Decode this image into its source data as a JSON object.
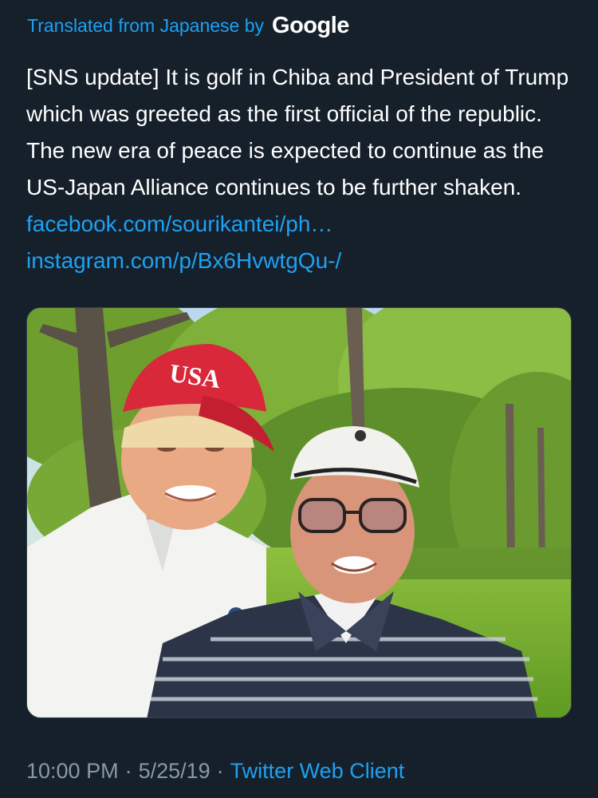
{
  "translation": {
    "prefix": "Translated from Japanese by",
    "provider": "Google"
  },
  "tweet": {
    "text": "[SNS update] It is golf in Chiba and President of Trump which was greeted as the first official of the republic. The new era of peace is expected to continue as the US-Japan Alliance continues to be further shaken. ",
    "link1": "facebook.com/sourikantei/ph…",
    "link2": "instagram.com/p/Bx6HvwtgQu-/"
  },
  "photo": {
    "cap_text": "USA"
  },
  "meta": {
    "time": "10:00 PM",
    "separator": "·",
    "date": "5/25/19",
    "client": "Twitter Web Client"
  },
  "colors": {
    "background": "#15202b",
    "link": "#1da1f2",
    "secondary_text": "#8899a6"
  }
}
